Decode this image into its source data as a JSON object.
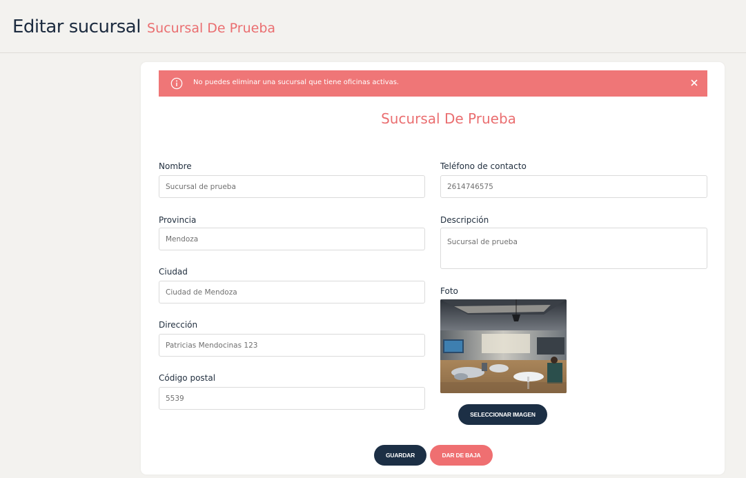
{
  "header": {
    "title": "Editar sucursal",
    "subtitle": "Sucursal De Prueba"
  },
  "alert": {
    "message": "No puedes eliminar una sucursal que tiene oficinas activas.",
    "icon": "info-icon",
    "close_icon": "close-icon",
    "color": "#ef7677"
  },
  "form": {
    "heading": "Sucursal De Prueba",
    "fields": {
      "nombre": {
        "label": "Nombre",
        "value": "Sucursal de prueba"
      },
      "provincia": {
        "label": "Provincia",
        "value": "Mendoza"
      },
      "ciudad": {
        "label": "Ciudad",
        "value": "Ciudad de Mendoza"
      },
      "direccion": {
        "label": "Dirección",
        "value": "Patricias Mendocinas 123"
      },
      "codigo_postal": {
        "label": "Código postal",
        "value": "5539"
      },
      "telefono": {
        "label": "Teléfono de contacto",
        "value": "2614746575"
      },
      "descripcion": {
        "label": "Descripción",
        "value": "Sucursal de prueba"
      },
      "foto": {
        "label": "Foto"
      }
    },
    "buttons": {
      "select_image": "SELECCIONAR IMAGEN",
      "save": "GUARDAR",
      "deactivate": "DAR DE BAJA"
    }
  },
  "colors": {
    "accent": "#ea6e70",
    "primary_dark": "#1c2f45",
    "danger": "#ef6f71"
  }
}
